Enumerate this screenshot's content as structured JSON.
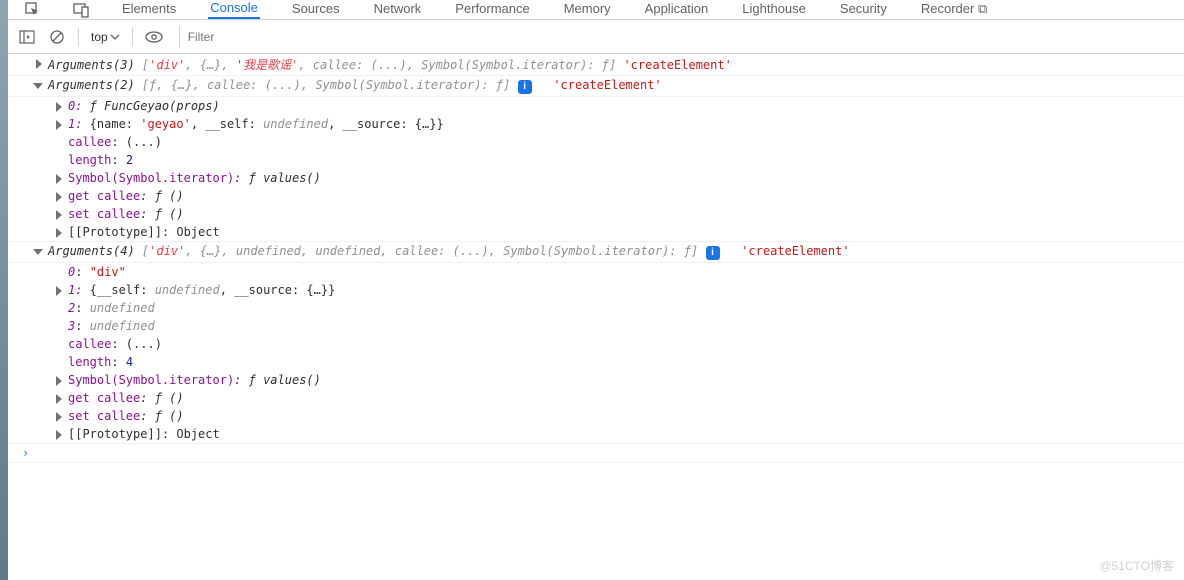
{
  "tabs": {
    "elements": "Elements",
    "console": "Console",
    "sources": "Sources",
    "network": "Network",
    "performance": "Performance",
    "memory": "Memory",
    "application": "Application",
    "lighthouse": "Lighthouse",
    "security": "Security",
    "recorder": "Recorder"
  },
  "toolbar": {
    "context": "top",
    "filter_placeholder": "Filter"
  },
  "glyph": {
    "i": "i",
    "preview": "⧉"
  },
  "log1": {
    "head_pre": "Arguments(3) ",
    "head_bracket1": "[",
    "head_div": "'div'",
    "head_c1": ", ",
    "head_obj": "{…}",
    "head_c2": ", ",
    "head_geyao": "'我是歌谣'",
    "head_c3": ", callee: (...), Symbol(Symbol.iterator): ƒ]",
    "tag": "'createElement'"
  },
  "log2": {
    "head_pre": "Arguments(2) ",
    "head_body": "[ƒ, {…}, callee: (...), Symbol(Symbol.iterator): ƒ]",
    "tag": "'createElement'",
    "l0_k": "0:",
    "l0_v": " ƒ FuncGeyao(props)",
    "l1_k": "1:",
    "l1_name_k": " {name: ",
    "l1_name_v": "'geyao'",
    "l1_self_k": ", __self: ",
    "l1_self_v": "undefined",
    "l1_src": ", __source: {…}}",
    "callee_k": "callee",
    "callee_v": ": (...)",
    "length_k": "length",
    "length_c": ": ",
    "length_v": "2",
    "sym_k": "Symbol(Symbol.iterator)",
    "sym_v": ": ƒ values()",
    "getc_k": "get callee",
    "getc_v": ": ƒ ()",
    "setc_k": "set callee",
    "setc_v": ": ƒ ()",
    "proto_k": "[[Prototype]]",
    "proto_v": ": Object"
  },
  "log3": {
    "head_pre": "Arguments(4) ",
    "head_b1": "[",
    "head_div": "'div'",
    "head_c1": ", ",
    "head_obj": "{…}",
    "head_c2": ", ",
    "head_u1": "undefined",
    "head_c3": ", ",
    "head_u2": "undefined",
    "head_rest": ", callee: (...), Symbol(Symbol.iterator): ƒ]",
    "tag": "'createElement'",
    "l0_k": "0",
    "l0_c": ": ",
    "l0_v": "\"div\"",
    "l1_k": "1:",
    "l1_self_k": " {__self: ",
    "l1_self_v": "undefined",
    "l1_src": ", __source: {…}}",
    "l2_k": "2",
    "l2_c": ": ",
    "l2_v": "undefined",
    "l3_k": "3",
    "l3_c": ": ",
    "l3_v": "undefined",
    "callee_k": "callee",
    "callee_v": ": (...)",
    "length_k": "length",
    "length_c": ": ",
    "length_v": "4",
    "sym_k": "Symbol(Symbol.iterator)",
    "sym_v": ": ƒ values()",
    "getc_k": "get callee",
    "getc_v": ": ƒ ()",
    "setc_k": "set callee",
    "setc_v": ": ƒ ()",
    "proto_k": "[[Prototype]]",
    "proto_v": ": Object"
  },
  "watermark": "@51CTO博客"
}
